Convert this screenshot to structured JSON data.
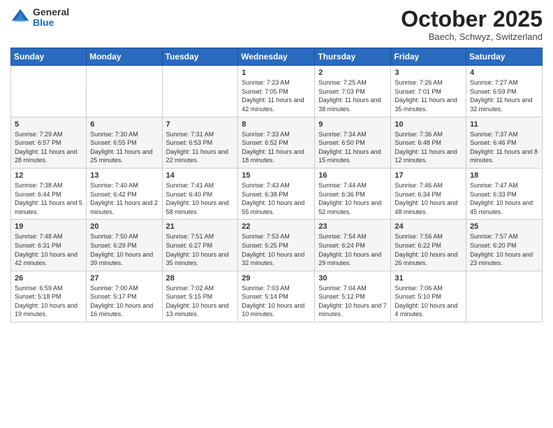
{
  "header": {
    "logo_general": "General",
    "logo_blue": "Blue",
    "month_title": "October 2025",
    "location": "Baech, Schwyz, Switzerland"
  },
  "weekdays": [
    "Sunday",
    "Monday",
    "Tuesday",
    "Wednesday",
    "Thursday",
    "Friday",
    "Saturday"
  ],
  "weeks": [
    [
      {
        "day": "",
        "info": ""
      },
      {
        "day": "",
        "info": ""
      },
      {
        "day": "",
        "info": ""
      },
      {
        "day": "1",
        "info": "Sunrise: 7:23 AM\nSunset: 7:05 PM\nDaylight: 11 hours\nand 42 minutes."
      },
      {
        "day": "2",
        "info": "Sunrise: 7:25 AM\nSunset: 7:03 PM\nDaylight: 11 hours\nand 38 minutes."
      },
      {
        "day": "3",
        "info": "Sunrise: 7:26 AM\nSunset: 7:01 PM\nDaylight: 11 hours\nand 35 minutes."
      },
      {
        "day": "4",
        "info": "Sunrise: 7:27 AM\nSunset: 6:59 PM\nDaylight: 11 hours\nand 32 minutes."
      }
    ],
    [
      {
        "day": "5",
        "info": "Sunrise: 7:29 AM\nSunset: 6:57 PM\nDaylight: 11 hours\nand 28 minutes."
      },
      {
        "day": "6",
        "info": "Sunrise: 7:30 AM\nSunset: 6:55 PM\nDaylight: 11 hours\nand 25 minutes."
      },
      {
        "day": "7",
        "info": "Sunrise: 7:31 AM\nSunset: 6:53 PM\nDaylight: 11 hours\nand 22 minutes."
      },
      {
        "day": "8",
        "info": "Sunrise: 7:33 AM\nSunset: 6:52 PM\nDaylight: 11 hours\nand 18 minutes."
      },
      {
        "day": "9",
        "info": "Sunrise: 7:34 AM\nSunset: 6:50 PM\nDaylight: 11 hours\nand 15 minutes."
      },
      {
        "day": "10",
        "info": "Sunrise: 7:36 AM\nSunset: 6:48 PM\nDaylight: 11 hours\nand 12 minutes."
      },
      {
        "day": "11",
        "info": "Sunrise: 7:37 AM\nSunset: 6:46 PM\nDaylight: 11 hours\nand 8 minutes."
      }
    ],
    [
      {
        "day": "12",
        "info": "Sunrise: 7:38 AM\nSunset: 6:44 PM\nDaylight: 11 hours\nand 5 minutes."
      },
      {
        "day": "13",
        "info": "Sunrise: 7:40 AM\nSunset: 6:42 PM\nDaylight: 11 hours\nand 2 minutes."
      },
      {
        "day": "14",
        "info": "Sunrise: 7:41 AM\nSunset: 6:40 PM\nDaylight: 10 hours\nand 58 minutes."
      },
      {
        "day": "15",
        "info": "Sunrise: 7:43 AM\nSunset: 6:38 PM\nDaylight: 10 hours\nand 55 minutes."
      },
      {
        "day": "16",
        "info": "Sunrise: 7:44 AM\nSunset: 6:36 PM\nDaylight: 10 hours\nand 52 minutes."
      },
      {
        "day": "17",
        "info": "Sunrise: 7:46 AM\nSunset: 6:34 PM\nDaylight: 10 hours\nand 48 minutes."
      },
      {
        "day": "18",
        "info": "Sunrise: 7:47 AM\nSunset: 6:33 PM\nDaylight: 10 hours\nand 45 minutes."
      }
    ],
    [
      {
        "day": "19",
        "info": "Sunrise: 7:48 AM\nSunset: 6:31 PM\nDaylight: 10 hours\nand 42 minutes."
      },
      {
        "day": "20",
        "info": "Sunrise: 7:50 AM\nSunset: 6:29 PM\nDaylight: 10 hours\nand 39 minutes."
      },
      {
        "day": "21",
        "info": "Sunrise: 7:51 AM\nSunset: 6:27 PM\nDaylight: 10 hours\nand 35 minutes."
      },
      {
        "day": "22",
        "info": "Sunrise: 7:53 AM\nSunset: 6:25 PM\nDaylight: 10 hours\nand 32 minutes."
      },
      {
        "day": "23",
        "info": "Sunrise: 7:54 AM\nSunset: 6:24 PM\nDaylight: 10 hours\nand 29 minutes."
      },
      {
        "day": "24",
        "info": "Sunrise: 7:56 AM\nSunset: 6:22 PM\nDaylight: 10 hours\nand 26 minutes."
      },
      {
        "day": "25",
        "info": "Sunrise: 7:57 AM\nSunset: 6:20 PM\nDaylight: 10 hours\nand 23 minutes."
      }
    ],
    [
      {
        "day": "26",
        "info": "Sunrise: 6:59 AM\nSunset: 5:18 PM\nDaylight: 10 hours\nand 19 minutes."
      },
      {
        "day": "27",
        "info": "Sunrise: 7:00 AM\nSunset: 5:17 PM\nDaylight: 10 hours\nand 16 minutes."
      },
      {
        "day": "28",
        "info": "Sunrise: 7:02 AM\nSunset: 5:15 PM\nDaylight: 10 hours\nand 13 minutes."
      },
      {
        "day": "29",
        "info": "Sunrise: 7:03 AM\nSunset: 5:14 PM\nDaylight: 10 hours\nand 10 minutes."
      },
      {
        "day": "30",
        "info": "Sunrise: 7:04 AM\nSunset: 5:12 PM\nDaylight: 10 hours\nand 7 minutes."
      },
      {
        "day": "31",
        "info": "Sunrise: 7:06 AM\nSunset: 5:10 PM\nDaylight: 10 hours\nand 4 minutes."
      },
      {
        "day": "",
        "info": ""
      }
    ]
  ]
}
